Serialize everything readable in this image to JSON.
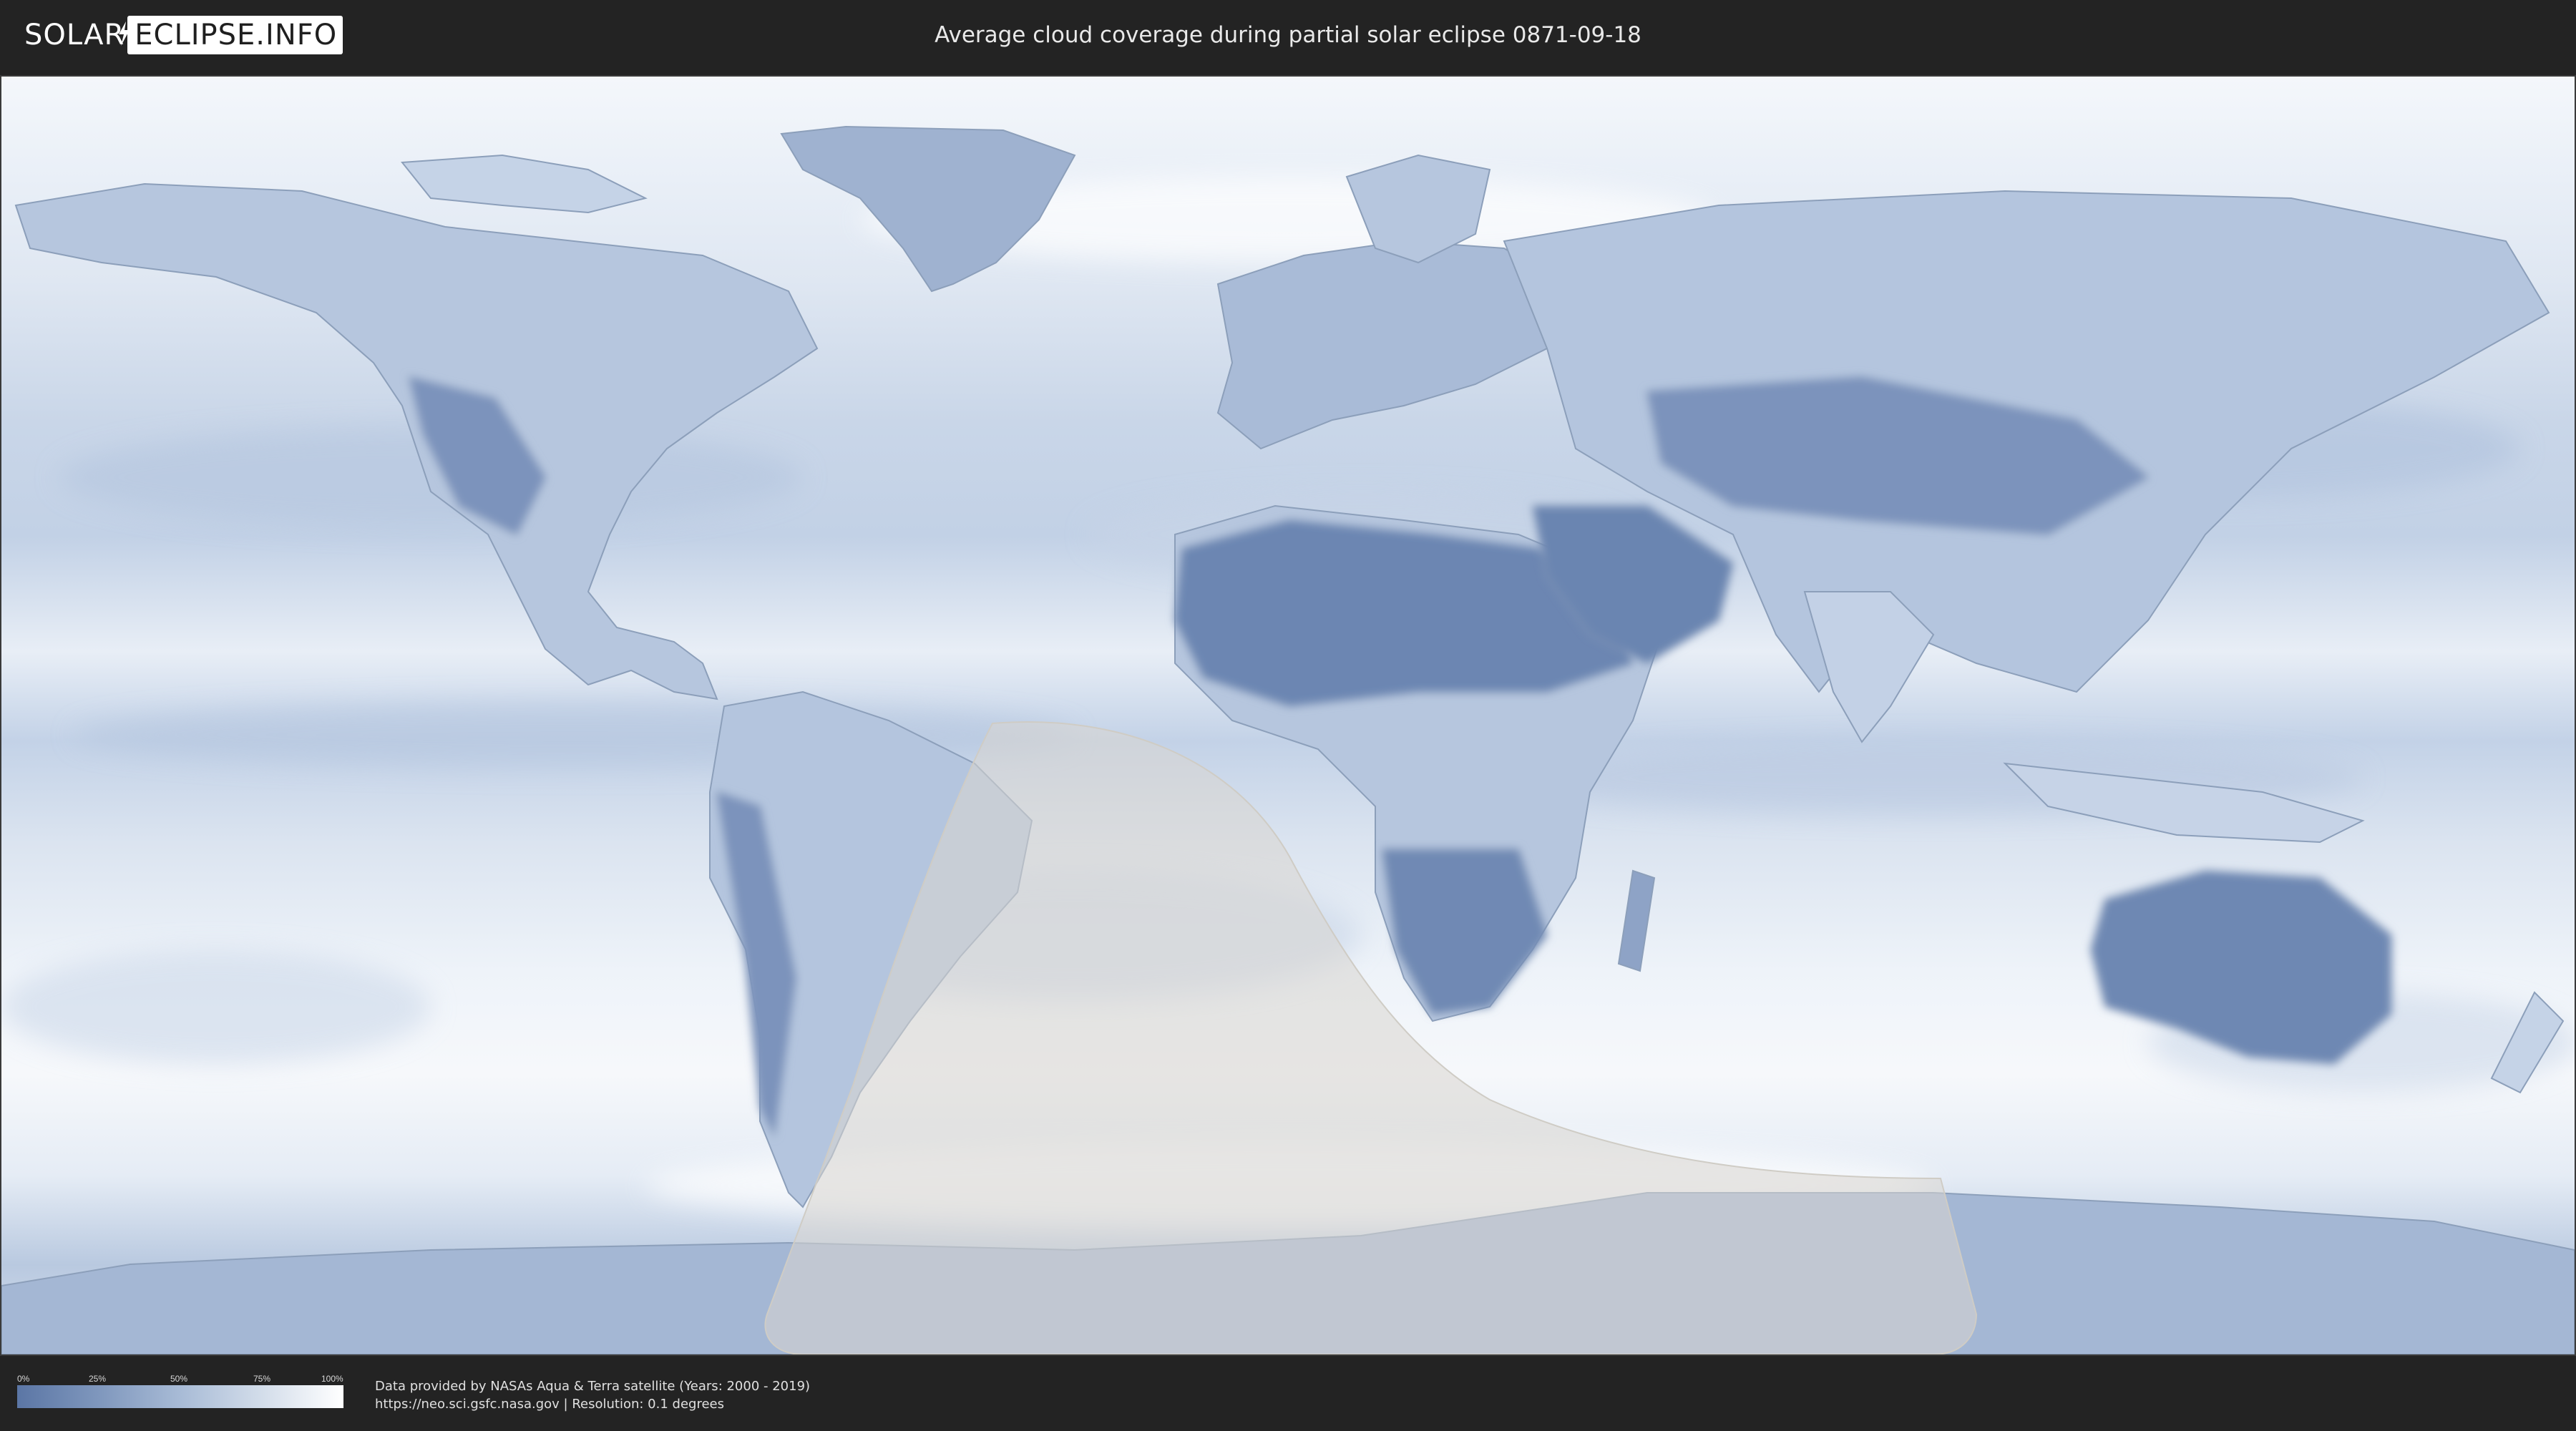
{
  "header": {
    "logo_left": "SOLAR",
    "logo_right": "ECLIPSE.INFO",
    "title": "Average cloud coverage during partial solar eclipse 0871-09-18"
  },
  "map": {
    "type": "world cloud-coverage map, equirectangular projection",
    "eclipse_visibility_region": "partial eclipse area over the South Atlantic, Southern Ocean and Antarctica",
    "colors": {
      "clear": "#5b76a5",
      "cloudy": "#ffffff",
      "eclipse_overlay": "#d9d6cf"
    }
  },
  "legend": {
    "ticks": [
      "0%",
      "25%",
      "50%",
      "75%",
      "100%"
    ],
    "colors": [
      "#5b76a5",
      "#7f97bd",
      "#a8bbd6",
      "#d3ddea",
      "#ffffff"
    ]
  },
  "footer": {
    "line1": "Data provided by NASAs Aqua & Terra satellite (Years: 2000 - 2019)",
    "line2": "https://neo.sci.gsfc.nasa.gov | Resolution: 0.1 degrees"
  }
}
